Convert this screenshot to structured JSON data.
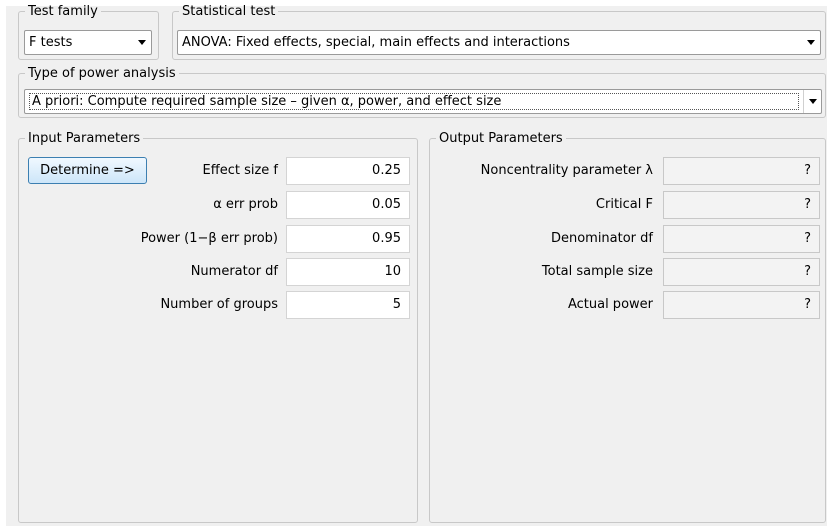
{
  "test_family": {
    "legend": "Test family",
    "selected": "F tests"
  },
  "statistical_test": {
    "legend": "Statistical test",
    "selected": "ANOVA: Fixed effects, special, main effects and interactions"
  },
  "power_analysis": {
    "legend": "Type of power analysis",
    "selected": "A priori: Compute required sample size – given α, power, and effect size"
  },
  "input_parameters": {
    "legend": "Input Parameters",
    "determine_label": "Determine =>",
    "rows": [
      {
        "label": "Effect size f",
        "value": "0.25"
      },
      {
        "label": "α err prob",
        "value": "0.05"
      },
      {
        "label": "Power (1−β err prob)",
        "value": "0.95"
      },
      {
        "label": "Numerator df",
        "value": "10"
      },
      {
        "label": "Number of groups",
        "value": "5"
      }
    ]
  },
  "output_parameters": {
    "legend": "Output Parameters",
    "rows": [
      {
        "label": "Noncentrality parameter λ",
        "value": "?"
      },
      {
        "label": "Critical F",
        "value": "?"
      },
      {
        "label": "Denominator df",
        "value": "?"
      },
      {
        "label": "Total sample size",
        "value": "?"
      },
      {
        "label": "Actual power",
        "value": "?"
      }
    ]
  }
}
